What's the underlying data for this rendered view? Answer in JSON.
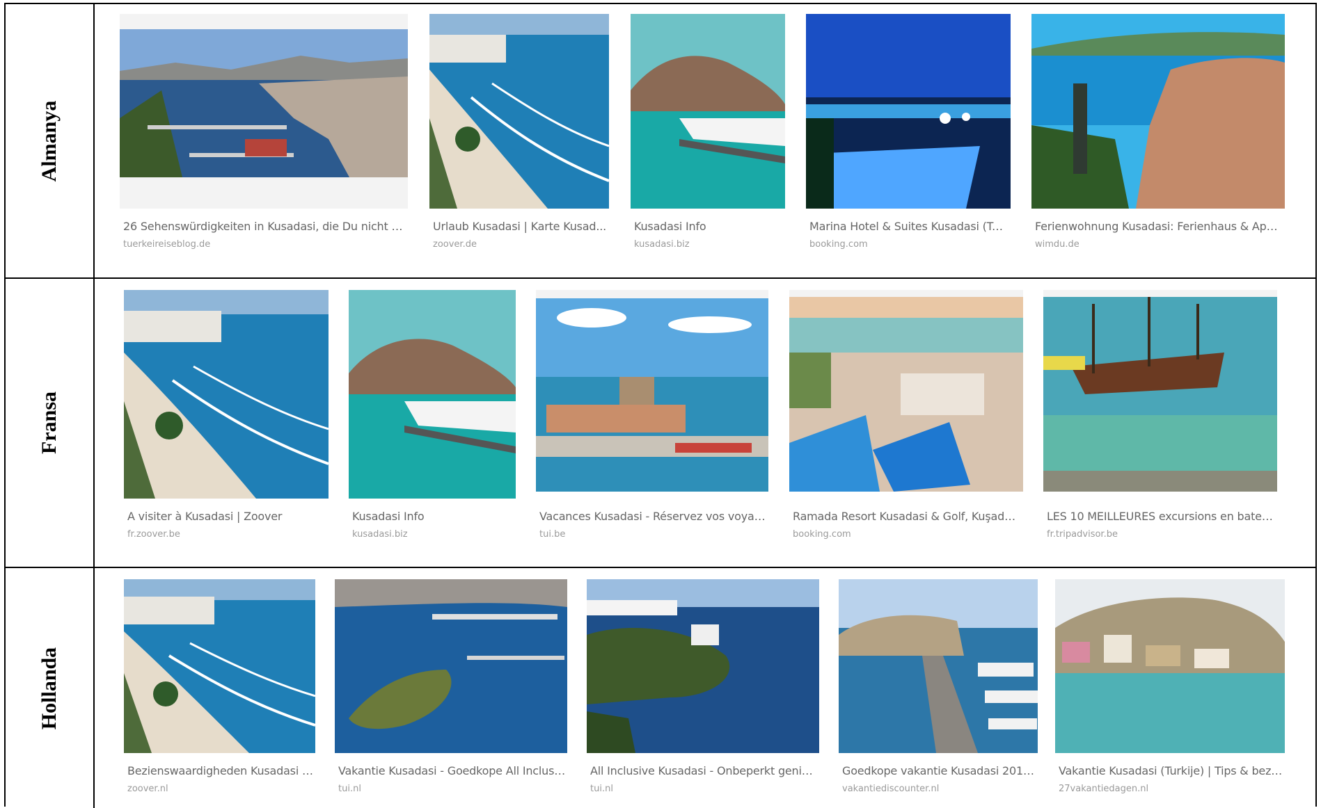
{
  "rows": [
    {
      "country": "Almanya",
      "results": [
        {
          "title": "26 Sehenswürdigkeiten in Kusadasi, die Du nicht ve...",
          "source": "tuerkeireiseblog.de",
          "scene": "panorama-bay-icon"
        },
        {
          "title": "Urlaub Kusadasi | Karte Kusad...",
          "source": "zoover.de",
          "scene": "beach-icon"
        },
        {
          "title": "Kusadasi Info",
          "source": "kusadasi.biz",
          "scene": "cruise-ship-icon"
        },
        {
          "title": "Marina Hotel & Suites Kusadasi (Tür...",
          "source": "booking.com",
          "scene": "night-pool-icon"
        },
        {
          "title": "Ferienwohnung Kusadasi: Ferienhaus & Apar...",
          "source": "wimdu.de",
          "scene": "statue-bay-icon"
        }
      ]
    },
    {
      "country": "Fransa",
      "results": [
        {
          "title": "A visiter à Kusadasi | Zoover",
          "source": "fr.zoover.be",
          "scene": "beach-icon"
        },
        {
          "title": "Kusadasi Info",
          "source": "kusadasi.biz",
          "scene": "cruise-ship-icon"
        },
        {
          "title": "Vacances Kusadasi - Réservez vos voyage ...",
          "source": "tui.be",
          "scene": "castle-harbor-icon"
        },
        {
          "title": "Ramada Resort Kusadasi & Golf, Kuşadası...",
          "source": "booking.com",
          "scene": "resort-pool-icon"
        },
        {
          "title": "LES 10 MEILLEURES excursions en batea...",
          "source": "fr.tripadvisor.be",
          "scene": "pirate-ship-icon"
        }
      ]
    },
    {
      "country": "Hollanda",
      "results": [
        {
          "title": "Bezienswaardigheden Kusadasi - ...",
          "source": "zoover.nl",
          "scene": "beach-icon"
        },
        {
          "title": "Vakantie Kusadasi - Goedkope All Inclusive ...",
          "source": "tui.nl",
          "scene": "island-aerial-icon"
        },
        {
          "title": "All Inclusive Kusadasi - Onbeperkt genieten...",
          "source": "tui.nl",
          "scene": "peninsula-icon"
        },
        {
          "title": "Goedkope vakantie Kusadasi 2019 | ...",
          "source": "vakantiediscounter.nl",
          "scene": "causeway-fort-icon"
        },
        {
          "title": "Vakantie Kusadasi (Turkije) | Tips & bezien...",
          "source": "27vakantiedagen.nl",
          "scene": "hillside-town-icon"
        }
      ]
    }
  ]
}
